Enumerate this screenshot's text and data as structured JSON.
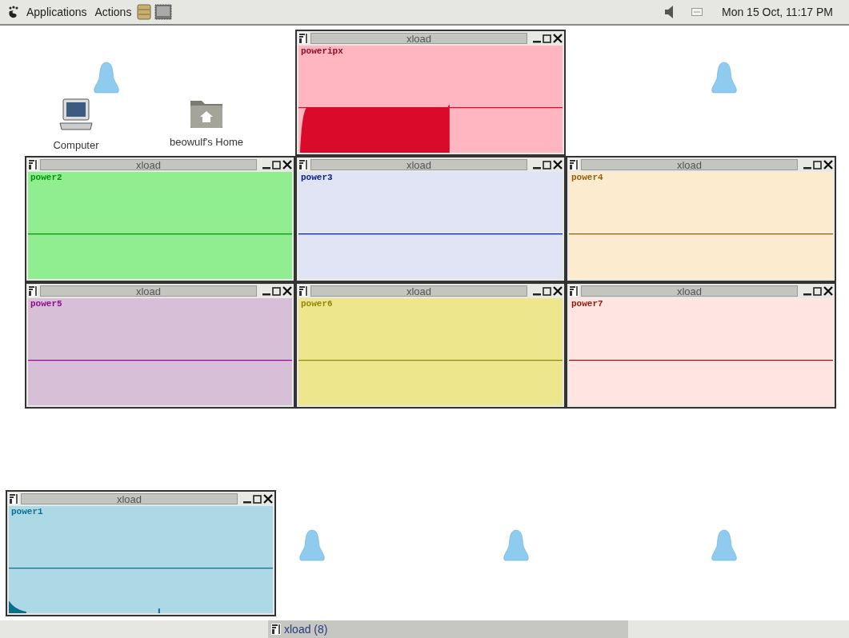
{
  "top_panel": {
    "menus": [
      "Applications",
      "Actions"
    ],
    "clock": "Mon 15 Oct, 11:17 PM"
  },
  "desktop_icons": [
    {
      "label": "Computer",
      "kind": "computer"
    },
    {
      "label": "beowulf's Home",
      "kind": "folder"
    }
  ],
  "window_rows": [
    {
      "windows": [
        {
          "title": "xload",
          "label": "poweripx",
          "color": "#ffb6c1",
          "kind": "high"
        }
      ]
    },
    {
      "windows": [
        {
          "title": "xload",
          "label": "power2",
          "color": "#90ee90",
          "kind": "flat"
        },
        {
          "title": "xload",
          "label": "power3",
          "color": "#e0e4f5",
          "kind": "flat"
        },
        {
          "title": "xload",
          "label": "power4",
          "color": "#fcebcf",
          "kind": "flat"
        }
      ]
    },
    {
      "windows": [
        {
          "title": "xload",
          "label": "power5",
          "color": "#d8bfd8",
          "kind": "flat"
        },
        {
          "title": "xload",
          "label": "power6",
          "color": "#eee68c",
          "kind": "flat"
        },
        {
          "title": "xload",
          "label": "power7",
          "color": "#ffe4e1",
          "kind": "flat"
        }
      ]
    }
  ],
  "floating_window": {
    "title": "xload",
    "label": "power1",
    "color": "#add8e6",
    "kind": "low"
  },
  "taskbar": {
    "button": "xload (8)"
  }
}
